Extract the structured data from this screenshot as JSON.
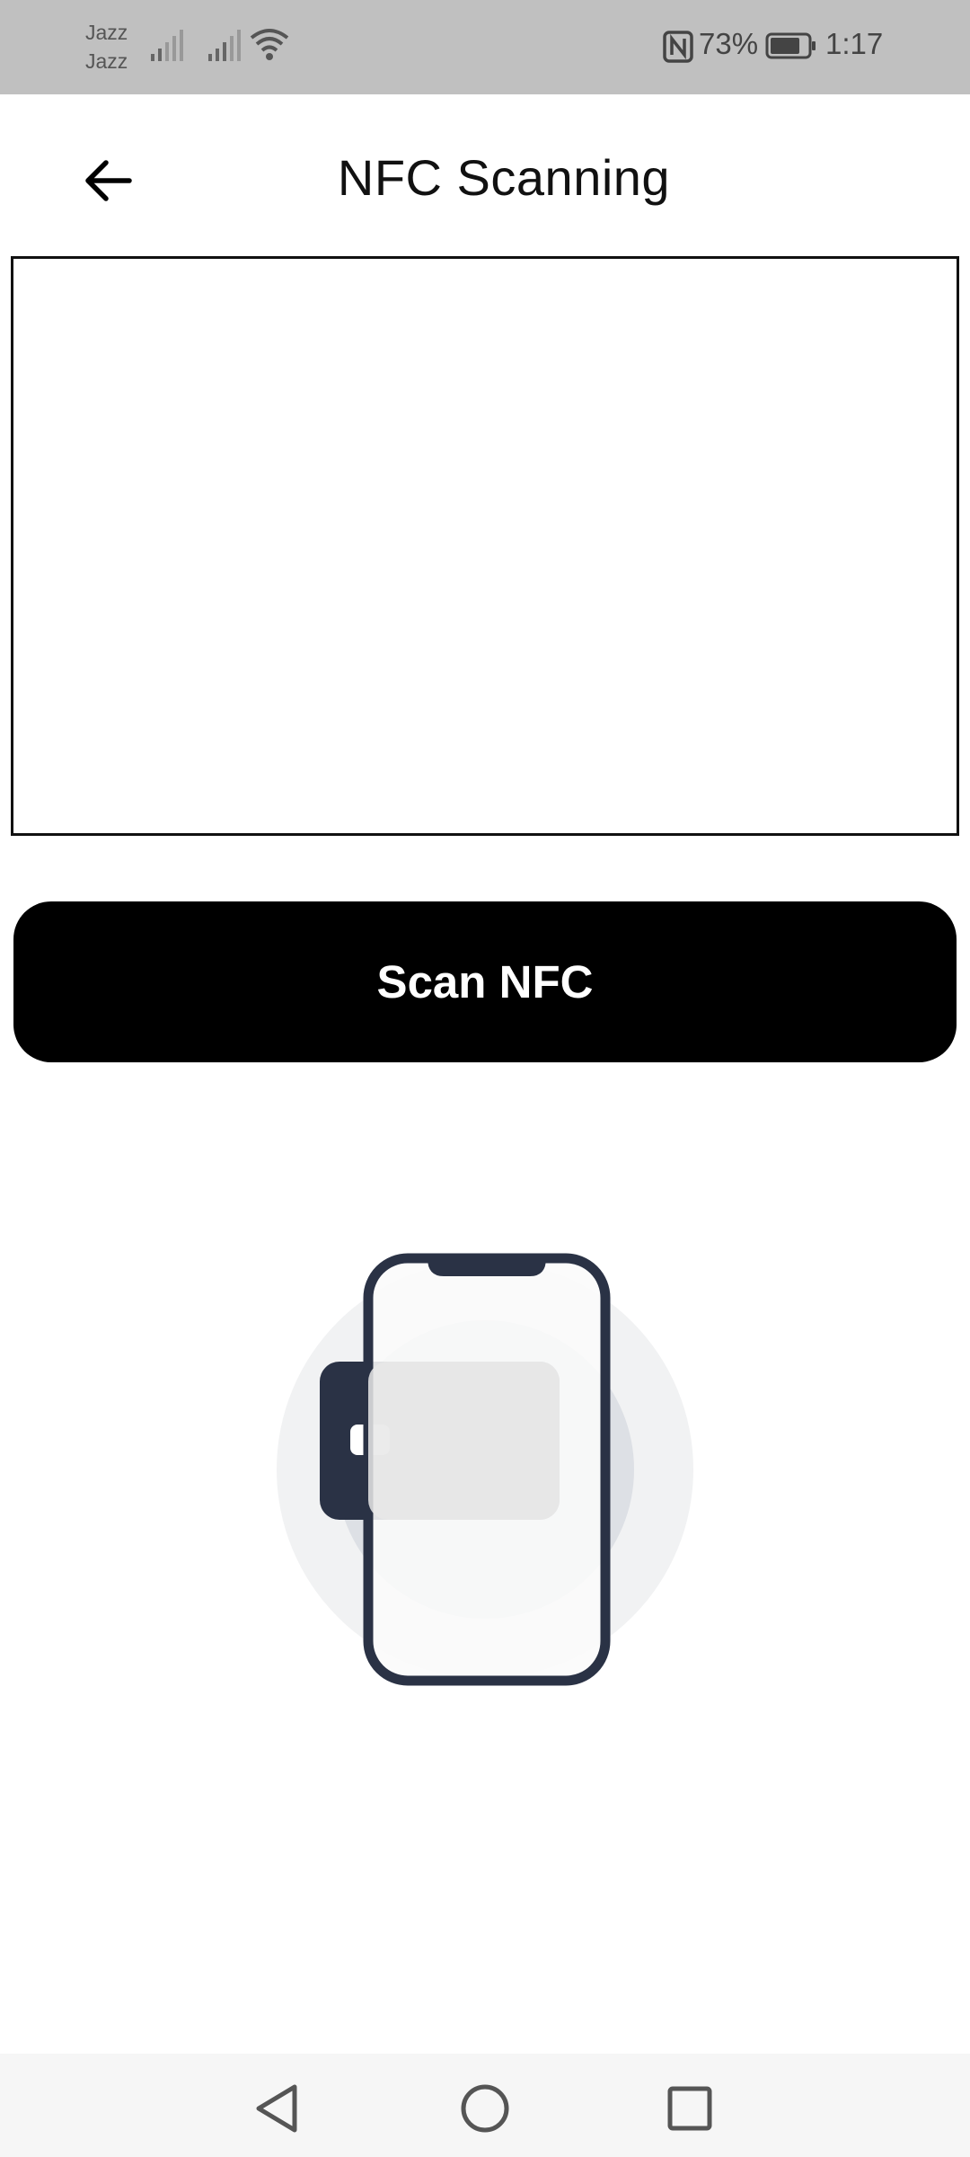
{
  "status_bar": {
    "carrier_1": "Jazz",
    "carrier_2": "Jazz",
    "battery_percent": "73%",
    "time": "1:17"
  },
  "app_bar": {
    "title": "NFC Scanning"
  },
  "result_box": {
    "text": ""
  },
  "scan_button": {
    "label": "Scan NFC"
  },
  "colors": {
    "status_bar_bg": "#c0c0c0",
    "button_bg": "#000000",
    "illustration_dark": "#2a3245",
    "illustration_light": "#eeeeee"
  },
  "icons": {
    "back": "arrow-left-icon",
    "nav_back": "triangle-back-icon",
    "nav_home": "circle-home-icon",
    "nav_recents": "square-recents-icon"
  }
}
